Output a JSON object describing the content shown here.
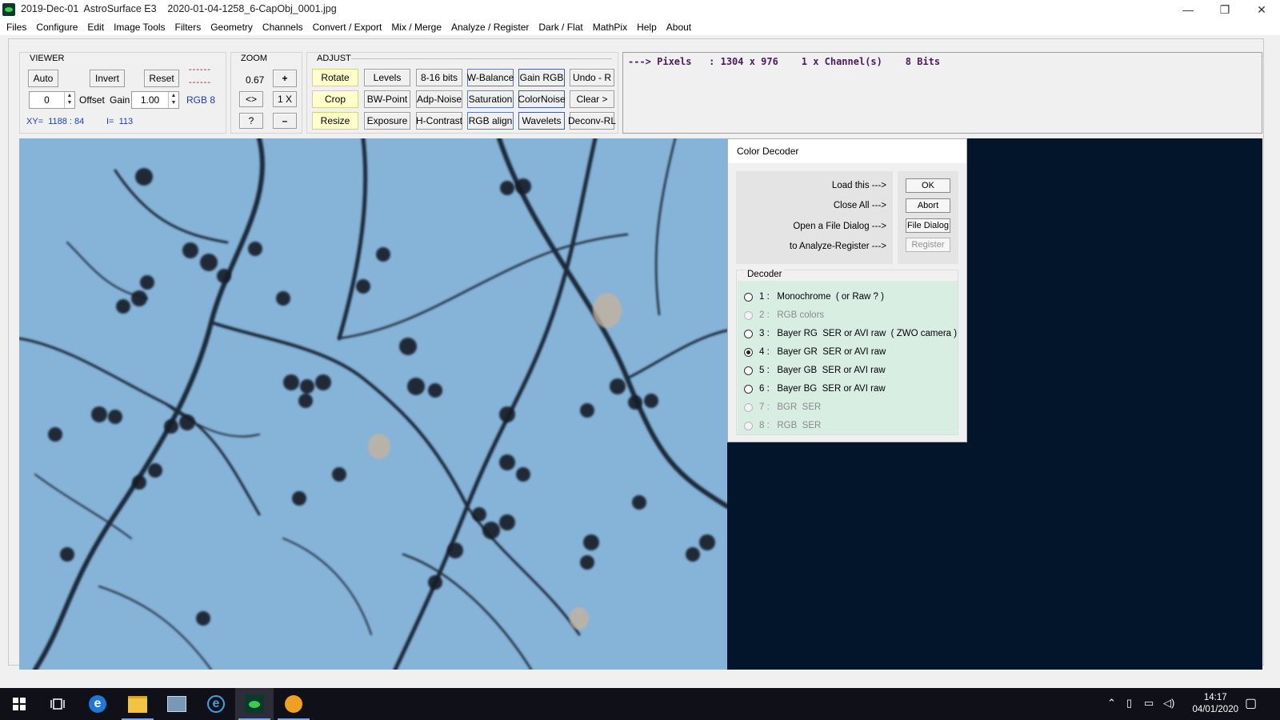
{
  "window": {
    "title": "2019-Dec-01  AstroSurface E3    2020-01-04-1258_6-CapObj_0001.jpg",
    "controls": [
      "—",
      "❐",
      "✕"
    ]
  },
  "menu": [
    "Files",
    "Configure",
    "Edit",
    "Image Tools",
    "Filters",
    "Geometry",
    "Channels",
    "Convert / Export",
    "Mix / Merge",
    "Analyze / Register",
    "Dark / Flat",
    "MathPix",
    "Help",
    "About"
  ],
  "viewer": {
    "label": "VIEWER",
    "auto": "Auto",
    "invert": "Invert",
    "reset": "Reset",
    "dash1": "------",
    "dash2": "------",
    "offset_value": "0",
    "offset_label": "Offset",
    "gain_label": "Gain",
    "gain_value": "1.00",
    "rgb_label": "RGB 8",
    "xy": "XY=  1188 : 84",
    "intensity": "I=  113"
  },
  "zoom": {
    "label": "ZOOM",
    "value": "0.67",
    "plus": "+",
    "fit": "<>",
    "one_x": "1 X",
    "question": "?",
    "minus": "–"
  },
  "adjust": {
    "label": "ADJUST",
    "buttons": [
      [
        "Rotate",
        "Levels",
        "8-16 bits",
        "W-Balance",
        "Gain RGB",
        "Undo - R"
      ],
      [
        "Crop",
        "BW-Point",
        "Adp-Noise",
        "Saturation",
        "ColorNoise",
        "Clear >"
      ],
      [
        "Resize",
        "Exposure",
        "H-Contrast",
        "RGB align",
        "Wavelets",
        "Deconv-RL"
      ]
    ]
  },
  "info": {
    "pixels": "---> Pixels   : 1304 x 976    1 x Channel(s)    8 Bits"
  },
  "dialog": {
    "title": "Color Decoder",
    "actions": [
      "Load this  --->",
      "Close All  --->",
      "Open a File Dialog  --->",
      "to Analyze-Register  --->"
    ],
    "buttons": {
      "ok": "OK",
      "abort": "Abort",
      "file_dialog": "File Dialog",
      "register": "Register"
    },
    "decoder_label": "Decoder",
    "options": [
      {
        "label": "1 :   Monochrome  ( or Raw ? )",
        "checked": false,
        "enabled": true
      },
      {
        "label": "2 :   RGB colors",
        "checked": false,
        "enabled": false
      },
      {
        "label": "3 :   Bayer RG  SER or AVI raw  ( ZWO camera )",
        "checked": false,
        "enabled": true
      },
      {
        "label": "4 :   Bayer GR  SER or AVI raw",
        "checked": true,
        "enabled": true
      },
      {
        "label": "5 :   Bayer GB  SER or AVI raw",
        "checked": false,
        "enabled": true
      },
      {
        "label": "6 :   Bayer BG  SER or AVI raw",
        "checked": false,
        "enabled": true
      },
      {
        "label": "7 :   BGR  SER",
        "checked": false,
        "enabled": false
      },
      {
        "label": "8 :   RGB  SER",
        "checked": false,
        "enabled": false
      }
    ]
  },
  "taskbar": {
    "time": "14:17",
    "date": "04/01/2020",
    "icons": [
      "windows-start-icon",
      "task-view-icon",
      "edge-icon",
      "file-explorer-icon",
      "control-panel-icon",
      "internet-explorer-icon",
      "astrosurface-icon",
      "autostakkert-icon"
    ]
  },
  "colors": {
    "sky": "#86b3d8",
    "dark_background": "#02152a",
    "decoder_bg": "#d9eee3",
    "accent_blue": "#1a3fb5"
  }
}
